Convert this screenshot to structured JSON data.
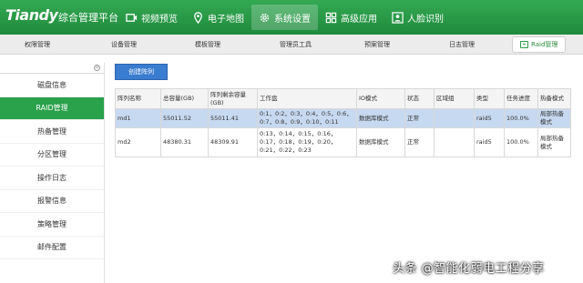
{
  "header": {
    "logo": "Tiandy",
    "app_title": "综合管理平台",
    "nav": [
      {
        "label": "视频预览",
        "icon": "video-preview-icon"
      },
      {
        "label": "电子地图",
        "icon": "map-icon"
      },
      {
        "label": "系统设置",
        "icon": "gear-icon",
        "active": true
      },
      {
        "label": "高级应用",
        "icon": "grid-apps-icon"
      },
      {
        "label": "人脸识别",
        "icon": "face-recognition-icon"
      }
    ],
    "colors": {
      "header": "#27994a",
      "accent": "#2aa14b"
    }
  },
  "subtabs": {
    "items": [
      "权限管理",
      "设备管理",
      "模板管理",
      "管理员工具",
      "预案管理",
      "日志管理",
      "Raid管理"
    ],
    "active_index": 6
  },
  "sidebar": {
    "items": [
      "磁盘信息",
      "RAID管理",
      "热备管理",
      "分区管理",
      "操作日志",
      "报警信息",
      "策略管理",
      "邮件配置"
    ],
    "active_index": 1
  },
  "main": {
    "create_button": "创建阵列",
    "table": {
      "headers": [
        "阵列名称",
        "总容量(GB)",
        "阵列剩余容量(GB)",
        "工作盘",
        "IO模式",
        "状态",
        "区域组",
        "类型",
        "任务进度",
        "热备模式"
      ],
      "rows": [
        [
          "md1",
          "55011.52",
          "55011.41",
          "0:1，0:2，0:3，0:4，0:5，0:6，0:7，0:8，0:9，0:10，0:11",
          "数据库模式",
          "正常",
          "",
          "raid5",
          "100.0%",
          "局部热备模式"
        ],
        [
          "md2",
          "48380.31",
          "48309.91",
          "0:13，0:14，0:15，0:16，0:17，0:18，0:19，0:20，0:21，0:22，0:23",
          "数据库模式",
          "正常",
          "",
          "raid5",
          "100.0%",
          "局部热备模式"
        ]
      ],
      "selected_row": 0
    }
  },
  "watermark": "头条 @智能化弱电工程分享"
}
